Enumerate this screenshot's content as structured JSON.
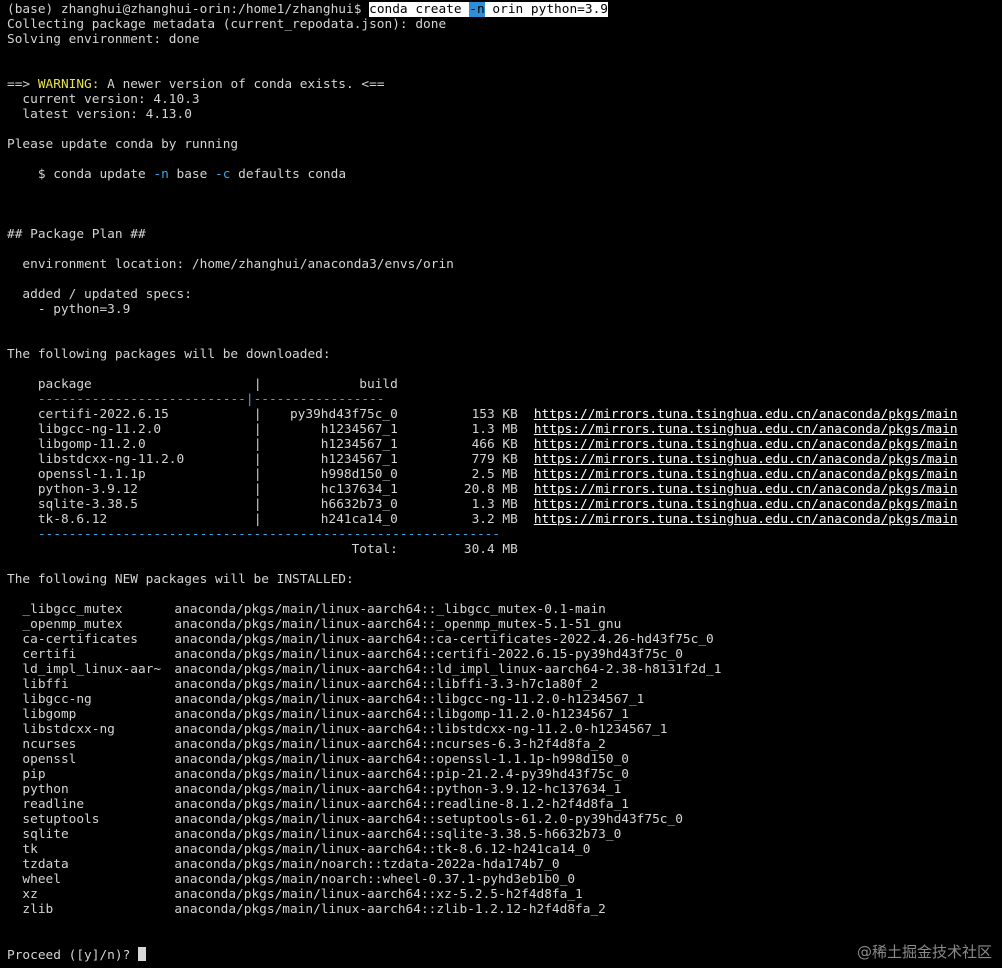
{
  "prompt": {
    "prefix": "(base) zhanghui@zhanghui-orin:/home1/zhanghui$ ",
    "cmd_a": "conda create ",
    "cmd_flag": "-n",
    "cmd_b": " orin python=3.9"
  },
  "header": {
    "collecting": "Collecting package metadata (current_repodata.json): done",
    "solving": "Solving environment: done"
  },
  "warning": {
    "arrow": "==> ",
    "label": "WARNING:",
    "text": " A newer version of conda exists. <==",
    "current": "  current version: 4.10.3",
    "latest": "  latest version: 4.13.0",
    "please": "Please update conda by running",
    "upd_a": "    $ conda update ",
    "upd_n": "-n",
    "upd_b": " base ",
    "upd_c": "-c",
    "upd_d": " defaults conda"
  },
  "plan": {
    "title": "## Package Plan ##",
    "env_location": "  environment location: /home/zhanghui/anaconda3/envs/orin",
    "specs_title": "  added / updated specs:",
    "spec": "    - python=3.9"
  },
  "download": {
    "title": "The following packages will be downloaded:",
    "col_package": "package",
    "col_sep": "|",
    "col_build": "build",
    "rule_a": "---------------------------",
    "rule_b": "|-----------------",
    "items": [
      {
        "pkg": "certifi-2022.6.15",
        "sep": "|",
        "build": "py39hd43f75c_0",
        "size": "153 KB",
        "url": "https://mirrors.tuna.tsinghua.edu.cn/anaconda/pkgs/main"
      },
      {
        "pkg": "libgcc-ng-11.2.0",
        "sep": "|",
        "build": "h1234567_1",
        "size": "1.3 MB",
        "url": "https://mirrors.tuna.tsinghua.edu.cn/anaconda/pkgs/main"
      },
      {
        "pkg": "libgomp-11.2.0",
        "sep": "|",
        "build": "h1234567_1",
        "size": "466 KB",
        "url": "https://mirrors.tuna.tsinghua.edu.cn/anaconda/pkgs/main"
      },
      {
        "pkg": "libstdcxx-ng-11.2.0",
        "sep": "|",
        "build": "h1234567_1",
        "size": "779 KB",
        "url": "https://mirrors.tuna.tsinghua.edu.cn/anaconda/pkgs/main"
      },
      {
        "pkg": "openssl-1.1.1p",
        "sep": "|",
        "build": "h998d150_0",
        "size": "2.5 MB",
        "url": "https://mirrors.tuna.tsinghua.edu.cn/anaconda/pkgs/main"
      },
      {
        "pkg": "python-3.9.12",
        "sep": "|",
        "build": "hc137634_1",
        "size": "20.8 MB",
        "url": "https://mirrors.tuna.tsinghua.edu.cn/anaconda/pkgs/main"
      },
      {
        "pkg": "sqlite-3.38.5",
        "sep": "|",
        "build": "h6632b73_0",
        "size": "1.3 MB",
        "url": "https://mirrors.tuna.tsinghua.edu.cn/anaconda/pkgs/main"
      },
      {
        "pkg": "tk-8.6.12",
        "sep": "|",
        "build": "h241ca14_0",
        "size": "3.2 MB",
        "url": "https://mirrors.tuna.tsinghua.edu.cn/anaconda/pkgs/main"
      }
    ],
    "rule_c": "------------------------------------------------------------",
    "total_label": "Total:",
    "total_size": "30.4 MB"
  },
  "install": {
    "title": "The following NEW packages will be INSTALLED:",
    "items": [
      {
        "name": "_libgcc_mutex",
        "src": "anaconda/pkgs/main/linux-aarch64::_libgcc_mutex-0.1-main"
      },
      {
        "name": "_openmp_mutex",
        "src": "anaconda/pkgs/main/linux-aarch64::_openmp_mutex-5.1-51_gnu"
      },
      {
        "name": "ca-certificates",
        "src": "anaconda/pkgs/main/linux-aarch64::ca-certificates-2022.4.26-hd43f75c_0"
      },
      {
        "name": "certifi",
        "src": "anaconda/pkgs/main/linux-aarch64::certifi-2022.6.15-py39hd43f75c_0"
      },
      {
        "name": "ld_impl_linux-aar~",
        "src": "anaconda/pkgs/main/linux-aarch64::ld_impl_linux-aarch64-2.38-h8131f2d_1"
      },
      {
        "name": "libffi",
        "src": "anaconda/pkgs/main/linux-aarch64::libffi-3.3-h7c1a80f_2"
      },
      {
        "name": "libgcc-ng",
        "src": "anaconda/pkgs/main/linux-aarch64::libgcc-ng-11.2.0-h1234567_1"
      },
      {
        "name": "libgomp",
        "src": "anaconda/pkgs/main/linux-aarch64::libgomp-11.2.0-h1234567_1"
      },
      {
        "name": "libstdcxx-ng",
        "src": "anaconda/pkgs/main/linux-aarch64::libstdcxx-ng-11.2.0-h1234567_1"
      },
      {
        "name": "ncurses",
        "src": "anaconda/pkgs/main/linux-aarch64::ncurses-6.3-h2f4d8fa_2"
      },
      {
        "name": "openssl",
        "src": "anaconda/pkgs/main/linux-aarch64::openssl-1.1.1p-h998d150_0"
      },
      {
        "name": "pip",
        "src": "anaconda/pkgs/main/linux-aarch64::pip-21.2.4-py39hd43f75c_0"
      },
      {
        "name": "python",
        "src": "anaconda/pkgs/main/linux-aarch64::python-3.9.12-hc137634_1"
      },
      {
        "name": "readline",
        "src": "anaconda/pkgs/main/linux-aarch64::readline-8.1.2-h2f4d8fa_1"
      },
      {
        "name": "setuptools",
        "src": "anaconda/pkgs/main/linux-aarch64::setuptools-61.2.0-py39hd43f75c_0"
      },
      {
        "name": "sqlite",
        "src": "anaconda/pkgs/main/linux-aarch64::sqlite-3.38.5-h6632b73_0"
      },
      {
        "name": "tk",
        "src": "anaconda/pkgs/main/linux-aarch64::tk-8.6.12-h241ca14_0"
      },
      {
        "name": "tzdata",
        "src": "anaconda/pkgs/main/noarch::tzdata-2022a-hda174b7_0"
      },
      {
        "name": "wheel",
        "src": "anaconda/pkgs/main/noarch::wheel-0.37.1-pyhd3eb1b0_0"
      },
      {
        "name": "xz",
        "src": "anaconda/pkgs/main/linux-aarch64::xz-5.2.5-h2f4d8fa_1"
      },
      {
        "name": "zlib",
        "src": "anaconda/pkgs/main/linux-aarch64::zlib-1.2.12-h2f4d8fa_2"
      }
    ]
  },
  "proceed": {
    "text": "Proceed ([y]/n)? "
  },
  "watermark": "@稀土掘金技术社区",
  "colors": {
    "background": "#000000",
    "foreground": "#d4d4d4",
    "warning": "#e8e048",
    "flag": "#3aa8e8",
    "selection": "#ffffff"
  }
}
